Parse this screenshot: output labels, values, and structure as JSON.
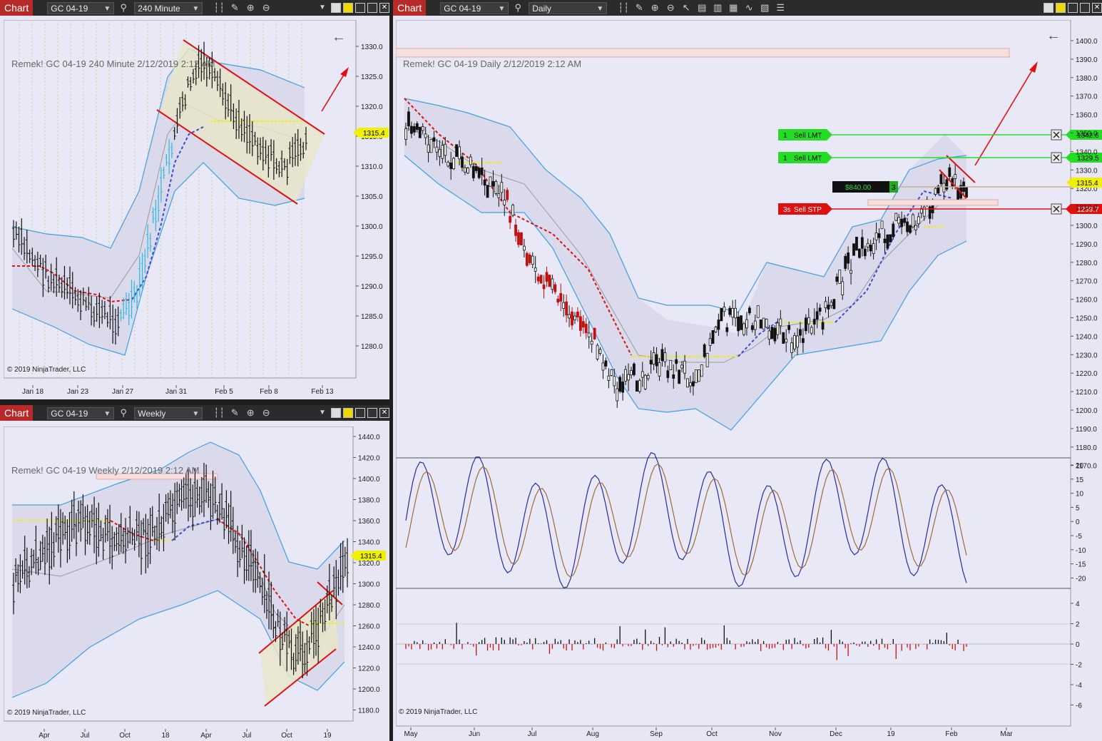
{
  "charts": {
    "c240": {
      "tab_label": "Chart",
      "instrument": "GC 04-19",
      "interval": "240 Minute",
      "title": "Remek!  GC 04-19  240 Minute  2/12/2019 2:12 AM",
      "copyright": "© 2019 NinjaTrader, LLC",
      "y_ticks": [
        "1330.0",
        "1325.0",
        "1320.0",
        "1315.0",
        "1310.0",
        "1305.0",
        "1300.0",
        "1295.0",
        "1290.0",
        "1285.0",
        "1280.0"
      ],
      "x_ticks": [
        "Jan 18",
        "Jan 23",
        "Jan 27",
        "Jan 31",
        "Feb 5",
        "Feb 8",
        "Feb 13"
      ],
      "last_price": "1315.4"
    },
    "cweekly": {
      "tab_label": "Chart",
      "instrument": "GC 04-19",
      "interval": "Weekly",
      "title": "Remek!  GC 04-19  Weekly  2/12/2019 2:12 AM",
      "copyright": "© 2019 NinjaTrader, LLC",
      "y_ticks": [
        "1440.0",
        "1420.0",
        "1400.0",
        "1380.0",
        "1360.0",
        "1340.0",
        "1320.0",
        "1300.0",
        "1280.0",
        "1260.0",
        "1240.0",
        "1220.0",
        "1200.0",
        "1180.0"
      ],
      "x_ticks": [
        "Apr",
        "Jul",
        "Oct",
        "18",
        "Apr",
        "Jul",
        "Oct",
        "19"
      ],
      "last_price": "1315.4"
    },
    "cdaily": {
      "tab_label": "Chart",
      "instrument": "GC 04-19",
      "interval": "Daily",
      "title": "Remek!  GC 04-19  Daily  2/12/2019 2:12 AM",
      "copyright": "© 2019 NinjaTrader, LLC",
      "y_ticks": [
        "1400.0",
        "1390.0",
        "1380.0",
        "1370.0",
        "1360.0",
        "1350.0",
        "1340.0",
        "1330.0",
        "1320.0",
        "1310.0",
        "1300.0",
        "1290.0",
        "1280.0",
        "1270.0",
        "1260.0",
        "1250.0",
        "1240.0",
        "1230.0",
        "1220.0",
        "1210.0",
        "1200.0",
        "1190.0",
        "1180.0",
        "1170.0"
      ],
      "x_ticks": [
        "May",
        "Jun",
        "Jul",
        "Aug",
        "Sep",
        "Oct",
        "Nov",
        "Dec",
        "19",
        "Feb",
        "Mar"
      ],
      "last_price": "1315.4",
      "osc_ticks": [
        "20",
        "15",
        "10",
        "5",
        "0",
        "-5",
        "-10",
        "-15",
        "-20"
      ],
      "hist_ticks": [
        "4",
        "2",
        "0",
        "-2",
        "-4",
        "-6"
      ],
      "orders": [
        {
          "qty": "1",
          "label": "Sell LMT",
          "price": "1342.6",
          "color": "#22dd22"
        },
        {
          "qty": "1",
          "label": "Sell LMT",
          "price": "1329.5",
          "color": "#22dd22"
        },
        {
          "qty": "3s",
          "label": "Sell STP",
          "price": "1299.7",
          "color": "#e01010"
        }
      ],
      "position": {
        "pnl": "$840.00",
        "qty": "3"
      }
    }
  }
}
